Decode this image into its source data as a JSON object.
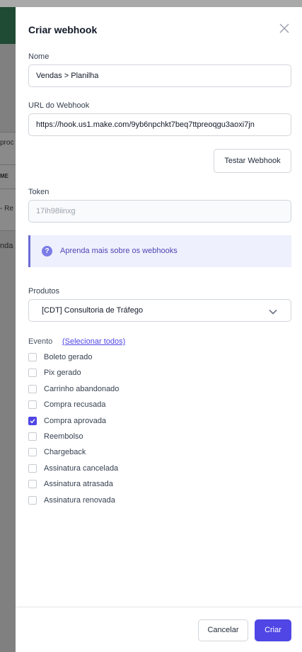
{
  "background": {
    "text_1": "proc",
    "text_2": "ME",
    "text_3": "- Re",
    "text_4": "nda"
  },
  "drawer": {
    "title": "Criar webhook",
    "name_label": "Nome",
    "name_value": "Vendas > Planilha",
    "url_label": "URL do Webhook",
    "url_value": "https://hook.us1.make.com/9yb6npchkt7beq7ttpreoqgu3aoxi7jn",
    "test_button": "Testar Webhook",
    "token_label": "Token",
    "token_value": "17ih98iinxg",
    "info_icon": "?",
    "info_text": "Aprenda mais sobre os webhooks",
    "products_label": "Produtos",
    "products_selected": "[CDT] Consultoria de Tráfego",
    "events_label": "Evento",
    "select_all": "(Selecionar todos)",
    "events": [
      {
        "label": "Boleto gerado",
        "checked": false
      },
      {
        "label": "Pix gerado",
        "checked": false
      },
      {
        "label": "Carrinho abandonado",
        "checked": false
      },
      {
        "label": "Compra recusada",
        "checked": false
      },
      {
        "label": "Compra aprovada",
        "checked": true
      },
      {
        "label": "Reembolso",
        "checked": false
      },
      {
        "label": "Chargeback",
        "checked": false
      },
      {
        "label": "Assinatura cancelada",
        "checked": false
      },
      {
        "label": "Assinatura atrasada",
        "checked": false
      },
      {
        "label": "Assinatura renovada",
        "checked": false
      }
    ],
    "cancel_button": "Cancelar",
    "create_button": "Criar"
  },
  "colors": {
    "accent": "#5046e5",
    "overlay": "#808080"
  }
}
